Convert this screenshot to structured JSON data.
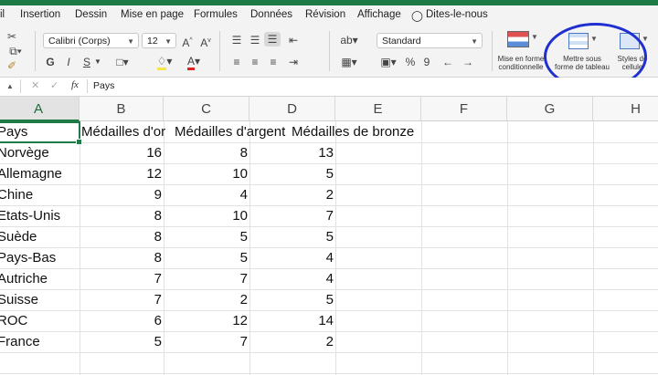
{
  "menu": [
    "il",
    "Insertion",
    "Dessin",
    "Mise en page",
    "Formules",
    "Données",
    "Révision",
    "Affichage",
    "Dites-le-nous"
  ],
  "ribbon": {
    "font_name": "Calibri (Corps)",
    "font_size": "12",
    "number_format": "Standard",
    "conditional_format_l1": "Mise en forme",
    "conditional_format_l2": "conditionnelle",
    "format_table_l1": "Mettre sous",
    "format_table_l2": "forme de tableau",
    "cell_styles_l1": "Styles de",
    "cell_styles_l2": "cellule",
    "bold": "G",
    "italic": "I",
    "underline": "S",
    "percent": "%",
    "thousands": "9"
  },
  "formula_bar": {
    "cell_ref": "",
    "fx": "fx",
    "content": "Pays"
  },
  "columns": [
    "A",
    "B",
    "C",
    "D",
    "E",
    "F",
    "G",
    "H"
  ],
  "header_row": [
    "Pays",
    "Médailles d'or",
    "Médailles d'argent",
    "Médailles de bronze"
  ],
  "rows": [
    {
      "country": "Norvège",
      "gold": "16",
      "silver": "8",
      "bronze": "13"
    },
    {
      "country": "Allemagne",
      "gold": "12",
      "silver": "10",
      "bronze": "5"
    },
    {
      "country": "Chine",
      "gold": "9",
      "silver": "4",
      "bronze": "2"
    },
    {
      "country": "Etats-Unis",
      "gold": "8",
      "silver": "10",
      "bronze": "7"
    },
    {
      "country": "Suède",
      "gold": "8",
      "silver": "5",
      "bronze": "5"
    },
    {
      "country": "Pays-Bas",
      "gold": "8",
      "silver": "5",
      "bronze": "4"
    },
    {
      "country": "Autriche",
      "gold": "7",
      "silver": "7",
      "bronze": "4"
    },
    {
      "country": "Suisse",
      "gold": "7",
      "silver": "2",
      "bronze": "5"
    },
    {
      "country": "ROC",
      "gold": "6",
      "silver": "12",
      "bronze": "14"
    },
    {
      "country": "France",
      "gold": "5",
      "silver": "7",
      "bronze": "2"
    }
  ],
  "colors": {
    "excel_green": "#1e7b45",
    "annotation_circle": "#1f2fd0"
  }
}
